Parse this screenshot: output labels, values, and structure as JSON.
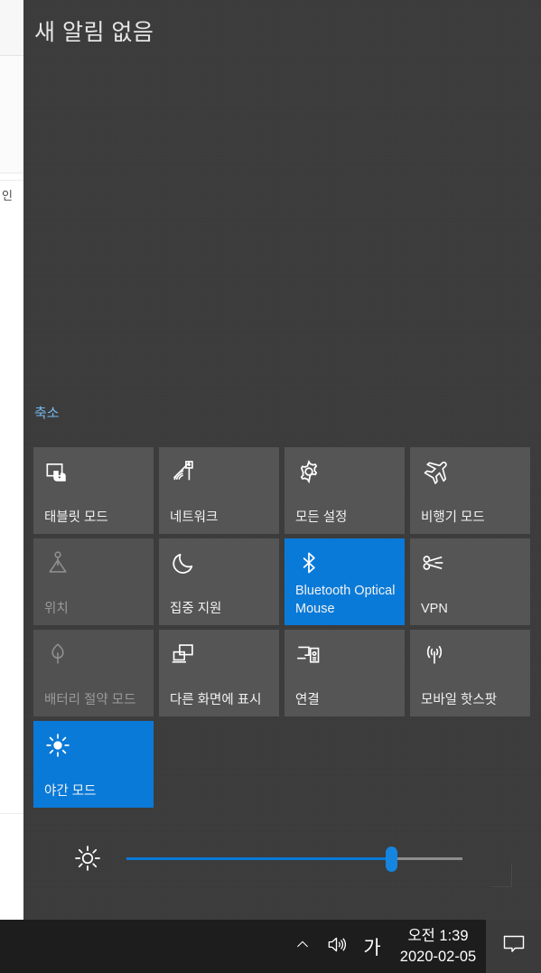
{
  "background_window": {
    "sliver_text": "인"
  },
  "action_center": {
    "header": "새 알림 없음",
    "collapse_link": "축소",
    "accent_color": "#0a7ad8",
    "panel_color": "#3b3b3b",
    "tile_color": "#555555",
    "tiles": [
      [
        {
          "label": "태블릿 모드",
          "icon": "tablet-mode-icon",
          "state": "off"
        },
        {
          "label": "네트워크",
          "icon": "network-wifi-icon",
          "state": "off"
        },
        {
          "label": "모든 설정",
          "icon": "gear-icon",
          "state": "off"
        },
        {
          "label": "비행기 모드",
          "icon": "airplane-icon",
          "state": "off"
        }
      ],
      [
        {
          "label": "위치",
          "icon": "location-icon",
          "state": "disabled"
        },
        {
          "label": "집중 지원",
          "icon": "moon-icon",
          "state": "off"
        },
        {
          "label": "Bluetooth Optical Mouse",
          "icon": "bluetooth-icon",
          "state": "on"
        },
        {
          "label": "VPN",
          "icon": "vpn-icon",
          "state": "off"
        }
      ],
      [
        {
          "label": "배터리 절약 모드",
          "icon": "leaf-battery-saver-icon",
          "state": "disabled"
        },
        {
          "label": "다른 화면에 표시",
          "icon": "project-display-icon",
          "state": "off"
        },
        {
          "label": "연결",
          "icon": "connect-cast-icon",
          "state": "off"
        },
        {
          "label": "모바일 핫스팟",
          "icon": "hotspot-broadcast-icon",
          "state": "off"
        }
      ],
      [
        {
          "label": "야간 모드",
          "icon": "night-light-sun-icon",
          "state": "on"
        },
        {
          "label": "",
          "icon": "",
          "state": "empty"
        },
        {
          "label": "",
          "icon": "",
          "state": "empty"
        },
        {
          "label": "",
          "icon": "",
          "state": "empty"
        }
      ]
    ],
    "brightness": {
      "icon": "brightness-sun-icon",
      "value_percent": 79
    }
  },
  "taskbar": {
    "show_hidden_icons": "chevron-up-icon",
    "volume": "speaker-icon",
    "ime_indicator": "가",
    "clock": {
      "time": "오전 1:39",
      "date": "2020-02-05"
    },
    "action_center_button": "notification-bubble-icon"
  }
}
